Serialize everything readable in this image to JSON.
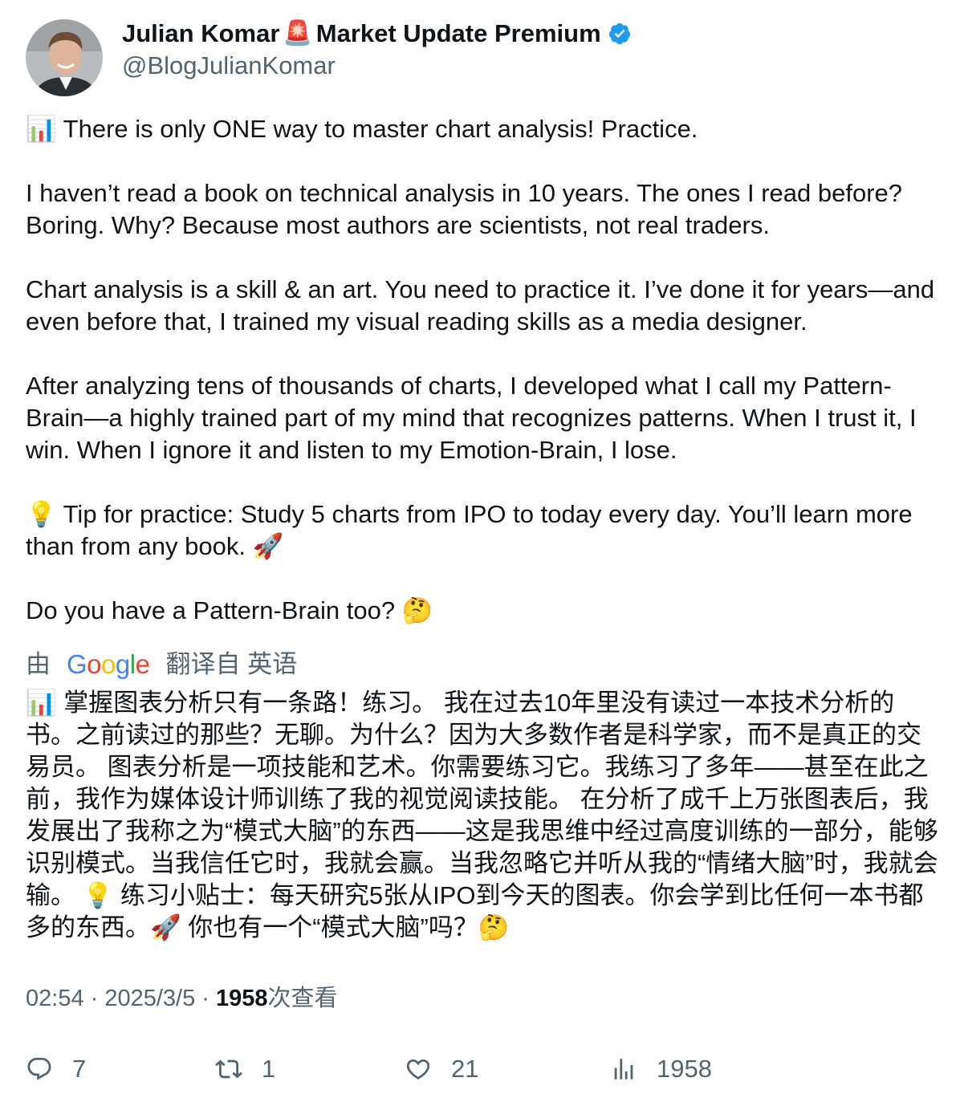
{
  "author": {
    "name_part1": "Julian Komar",
    "emoji": "🚨",
    "name_part2": "Market Update Premium",
    "handle": "@BlogJulianKomar"
  },
  "post": {
    "paragraphs": [
      "📊 There is only ONE way to master chart analysis! Practice.",
      "I haven’t read a book on technical analysis in 10 years. The ones I read before? Boring. Why? Because most authors are scientists, not real traders.",
      "Chart analysis is a skill & an art. You need to practice it. I’ve done it for years—and even before that, I trained my visual reading skills as a media designer.",
      "After analyzing tens of thousands of charts, I developed what I call my Pattern-Brain—a highly trained part of my mind that recognizes patterns. When I trust it, I win. When I ignore it and listen to my Emotion-Brain, I lose.",
      "💡 Tip for practice: Study 5 charts from IPO to today every day. You’ll learn more than from any book. 🚀",
      "Do you have a Pattern-Brain too? 🤔"
    ]
  },
  "translation": {
    "prefix": "由",
    "logo_text": "Google",
    "suffix": "翻译自 英语",
    "text": "📊 掌握图表分析只有一条路！练习。 我在过去10年里没有读过一本技术分析的书。之前读过的那些？无聊。为什么？因为大多数作者是科学家，而不是真正的交易员。 图表分析是一项技能和艺术。你需要练习它。我练习了多年——甚至在此之前，我作为媒体设计师训练了我的视觉阅读技能。 在分析了成千上万张图表后，我发展出了我称之为“模式大脑”的东西——这是我思维中经过高度训练的一部分，能够识别模式。当我信任它时，我就会赢。当我忽略它并听从我的“情绪大脑”时，我就会输。 💡 练习小贴士：每天研究5张从IPO到今天的图表。你会学到比任何一本书都多的东西。🚀 你也有一个“模式大脑”吗？🤔"
  },
  "meta": {
    "time": "02:54",
    "sep1": " · ",
    "date": "2025/3/5",
    "sep2": " · ",
    "views_count": "1958",
    "views_label": "次查看"
  },
  "actions": {
    "reply_count": "7",
    "repost_count": "1",
    "like_count": "21",
    "views_count": "1958"
  },
  "icons": [
    "avatar",
    "verified-badge-icon",
    "reply-icon",
    "repost-icon",
    "like-icon",
    "views-icon"
  ],
  "colors": {
    "text": "#0f1419",
    "secondary": "#536471",
    "verified": "#1d9bf0"
  }
}
